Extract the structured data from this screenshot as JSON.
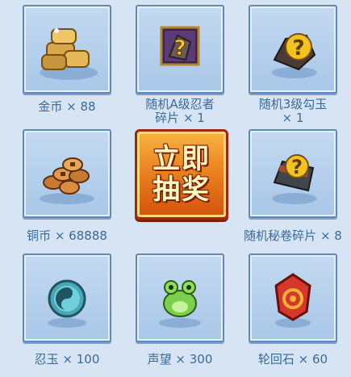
{
  "rewards": [
    {
      "label": "金币 × 88",
      "icon": "gold-bars-icon"
    },
    {
      "label": "随机A级忍者\n碎片 × 1",
      "icon": "mystery-ninja-fragment-icon"
    },
    {
      "label": "随机3级勾玉\n× 1",
      "icon": "mystery-magatama-icon"
    },
    {
      "label": "铜币 × 68888",
      "icon": "copper-coins-icon"
    },
    {
      "label": "随机秘卷碎片 × 8",
      "icon": "mystery-scroll-fragment-icon"
    },
    {
      "label": "忍玉 × 100",
      "icon": "ninja-jade-icon"
    },
    {
      "label": "声望 × 300",
      "icon": "reputation-frog-icon"
    },
    {
      "label": "轮回石 × 60",
      "icon": "rinne-stone-icon"
    }
  ],
  "draw_button": {
    "line1": "立即",
    "line2": "抽奖"
  },
  "colors": {
    "background": "#d6e4f3",
    "tile": "#b6d0ec",
    "border": "#5f88b9",
    "label": "#3a6a9a",
    "button": "#e77a1b"
  }
}
